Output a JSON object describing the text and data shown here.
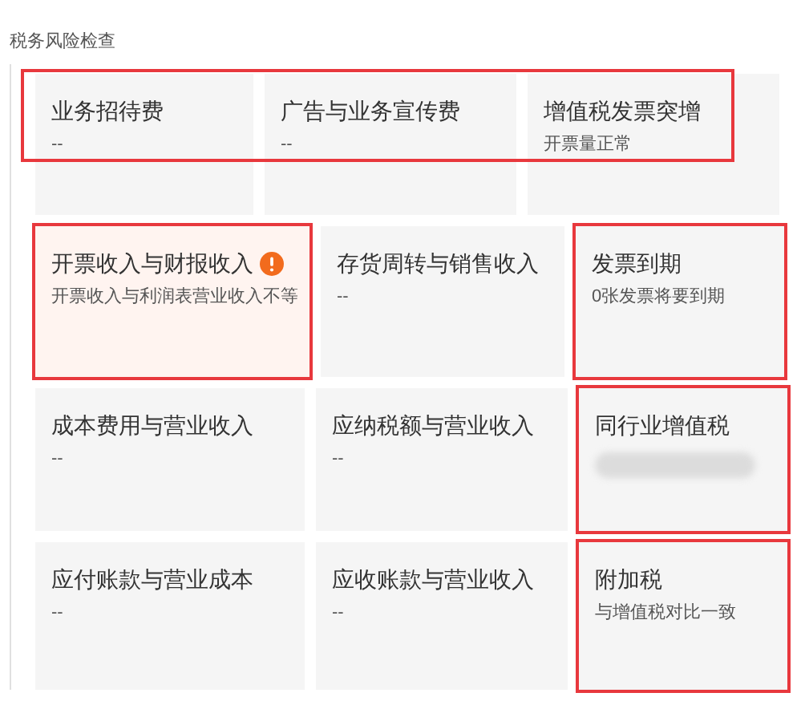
{
  "section_title": "税务风险检查",
  "rows": [
    {
      "highlighted": true,
      "cards": [
        {
          "title": "业务招待费",
          "value": "--",
          "warning": false,
          "highlighted": false
        },
        {
          "title": "广告与业务宣传费",
          "value": "--",
          "warning": false,
          "highlighted": false
        },
        {
          "title": "增值税发票突增",
          "value": "开票量正常",
          "warning": false,
          "highlighted": false
        }
      ]
    },
    {
      "highlighted": false,
      "cards": [
        {
          "title": "开票收入与财报收入",
          "value": "开票收入与利润表营业收入不等",
          "warning": true,
          "highlighted": true
        },
        {
          "title": "存货周转与销售收入",
          "value": "--",
          "warning": false,
          "highlighted": false
        },
        {
          "title": "发票到期",
          "value": "0张发票将要到期",
          "warning": false,
          "highlighted": true
        }
      ]
    },
    {
      "highlighted": false,
      "cards": [
        {
          "title": "成本费用与营业收入",
          "value": "--",
          "warning": false,
          "highlighted": false
        },
        {
          "title": "应纳税额与营业收入",
          "value": "--",
          "warning": false,
          "highlighted": false
        },
        {
          "title": "同行业增值税",
          "value_hidden": true,
          "warning": false,
          "highlighted": true
        }
      ]
    },
    {
      "highlighted": false,
      "cards": [
        {
          "title": "应付账款与营业成本",
          "value": "--",
          "warning": false,
          "highlighted": false
        },
        {
          "title": "应收账款与营业收入",
          "value": "--",
          "warning": false,
          "highlighted": false
        },
        {
          "title": "附加税",
          "value": "与增值税对比一致",
          "warning": false,
          "highlighted": true
        }
      ]
    }
  ]
}
